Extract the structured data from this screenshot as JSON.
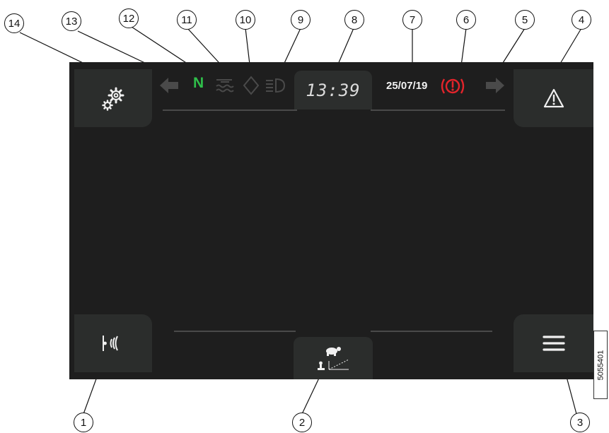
{
  "callouts": [
    "1",
    "2",
    "3",
    "4",
    "5",
    "6",
    "7",
    "8",
    "9",
    "10",
    "11",
    "12",
    "13",
    "14"
  ],
  "display": {
    "time": "13:39",
    "date": "25/07/19",
    "gear_indicator": "N"
  },
  "figure_ref": "5055401",
  "icons": {
    "settings": "gears-icon",
    "warning": "warning-triangle-icon",
    "menu": "hamburger-menu-icon",
    "rear_sensor": "park-sensor-icon",
    "speed_mode": "tortoise-speed-icon",
    "brake": "parking-brake-icon",
    "turn_left": "left-arrow-icon",
    "turn_right": "right-arrow-icon",
    "oil": "oil-level-icon",
    "coolant": "coolant-temp-icon",
    "headlight": "headlight-icon"
  },
  "colors": {
    "screen_bg": "#1e1e1e",
    "button_bg": "#2b2d2c",
    "neutral_green": "#2fbf4a",
    "brake_red": "#e3242b",
    "inactive_gray": "#4a4a4a"
  }
}
